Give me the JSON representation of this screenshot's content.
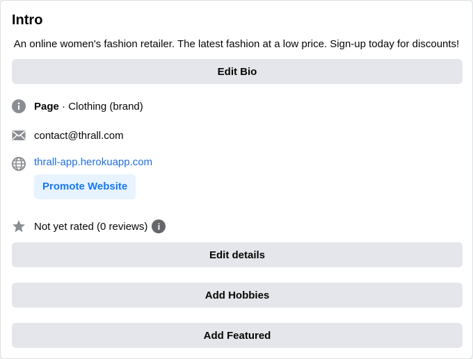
{
  "intro": {
    "title": "Intro",
    "bio": "An online women's fashion retailer. The latest fashion at a low price. Sign-up today for discounts!",
    "edit_bio_label": "Edit Bio"
  },
  "details": {
    "page_label": "Page",
    "page_category": " · Clothing (brand)",
    "email": "contact@thrall.com",
    "website": "thrall-app.herokuapp.com",
    "promote_label": "Promote Website",
    "rating_text": "Not yet rated (0 reviews)",
    "info_icon": "i"
  },
  "actions": {
    "edit_details_label": "Edit details",
    "add_hobbies_label": "Add Hobbies",
    "add_featured_label": "Add Featured"
  },
  "icons": {
    "info": "info-icon",
    "email": "envelope-icon",
    "website": "globe-icon",
    "rating": "star-icon"
  },
  "colors": {
    "button_bg": "#e4e6eb",
    "link": "#216fdb",
    "promote_bg": "#e7f3ff",
    "promote_text": "#1877f2",
    "icon": "#8a8d91"
  }
}
